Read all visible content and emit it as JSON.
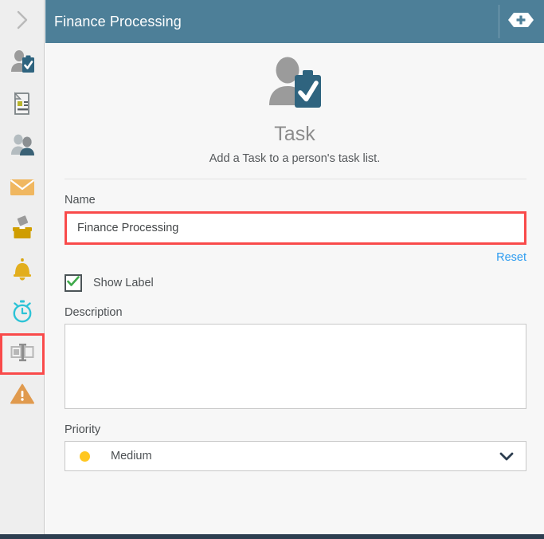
{
  "window": {
    "title": "Finance Processing"
  },
  "colors": {
    "header_bg": "#4d7f98",
    "panel_bg": "#f7f7f7",
    "rail_bg": "#eeeeee",
    "highlight_red": "#f94a4a",
    "link_blue": "#2e9cf0",
    "priority_yellow": "#ffc721",
    "checkbox_green": "#3faa4b",
    "bottom_bar": "#2d3e50"
  },
  "titlebar": {
    "title": "Finance Processing",
    "add_button_name": "add-button"
  },
  "sidebar": {
    "toggle_icon": "chevron-right-icon",
    "items": [
      {
        "icon": "person-task-icon",
        "name": "sidebar-item-person-task",
        "selected": false
      },
      {
        "icon": "document-icon",
        "name": "sidebar-item-document",
        "selected": false
      },
      {
        "icon": "people-group-icon",
        "name": "sidebar-item-people",
        "selected": false
      },
      {
        "icon": "envelope-icon",
        "name": "sidebar-item-mail",
        "selected": false
      },
      {
        "icon": "ballot-box-icon",
        "name": "sidebar-item-inbox",
        "selected": false
      },
      {
        "icon": "bell-icon",
        "name": "sidebar-item-notifications",
        "selected": false
      },
      {
        "icon": "stopwatch-icon",
        "name": "sidebar-item-timer",
        "selected": false
      },
      {
        "icon": "split-layout-icon",
        "name": "sidebar-item-layout",
        "selected": true
      },
      {
        "icon": "warning-triangle-icon",
        "name": "sidebar-item-alerts",
        "selected": false
      }
    ]
  },
  "hero": {
    "icon": "person-task-icon",
    "title": "Task",
    "subtitle": "Add a Task to a person's task list."
  },
  "form": {
    "name": {
      "label": "Name",
      "value": "Finance Processing",
      "placeholder": ""
    },
    "reset": {
      "label": "Reset"
    },
    "show_label": {
      "label": "Show Label",
      "checked": true
    },
    "description": {
      "label": "Description",
      "value": "",
      "placeholder": ""
    },
    "priority": {
      "label": "Priority",
      "selected": "Medium",
      "dot_color": "#ffc721",
      "chevron_icon": "chevron-down-icon"
    }
  }
}
